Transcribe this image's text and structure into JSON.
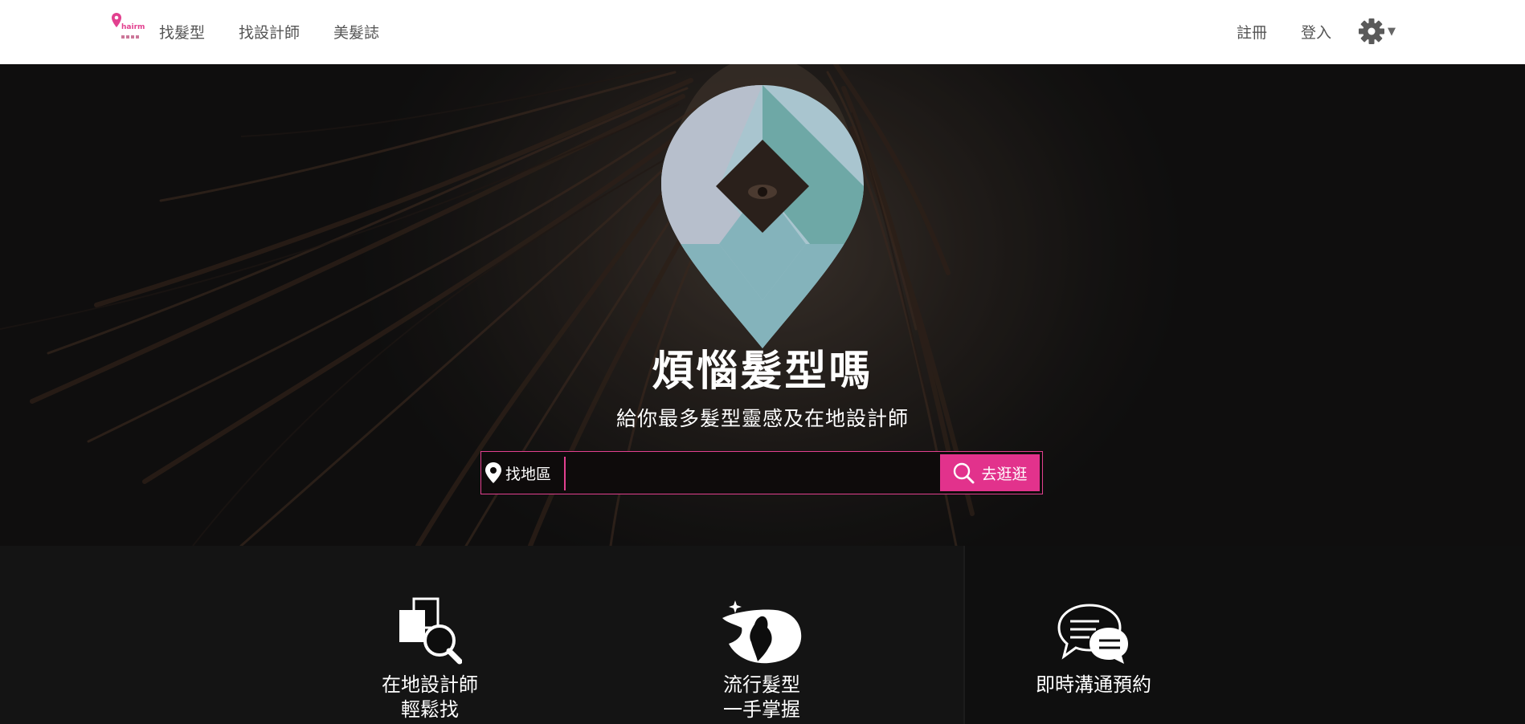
{
  "nav": {
    "logo_text": "hairmap",
    "links": [
      "找髮型",
      "找設計師",
      "美髮誌"
    ],
    "register": "註冊",
    "login": "登入",
    "settings_icon": "gear-icon"
  },
  "hero": {
    "title": "煩惱髮型嗎",
    "subtitle": "給你最多髮型靈感及在地設計師",
    "search": {
      "location_label": "找地區",
      "input_value": "",
      "button_label": "去逛逛"
    }
  },
  "features": [
    {
      "icon": "designer-search-icon",
      "line1": "在地設計師",
      "line2": "輕鬆找"
    },
    {
      "icon": "hairstyle-taiwan-icon",
      "line1": "流行髮型",
      "line2": "一手掌握"
    },
    {
      "icon": "chat-bubbles-icon",
      "line1": "即時溝通預約",
      "line2": ""
    }
  ],
  "colors": {
    "accent": "#e2328c",
    "logo_teal": "#6ea8a6",
    "logo_light": "#a9c5cf"
  }
}
